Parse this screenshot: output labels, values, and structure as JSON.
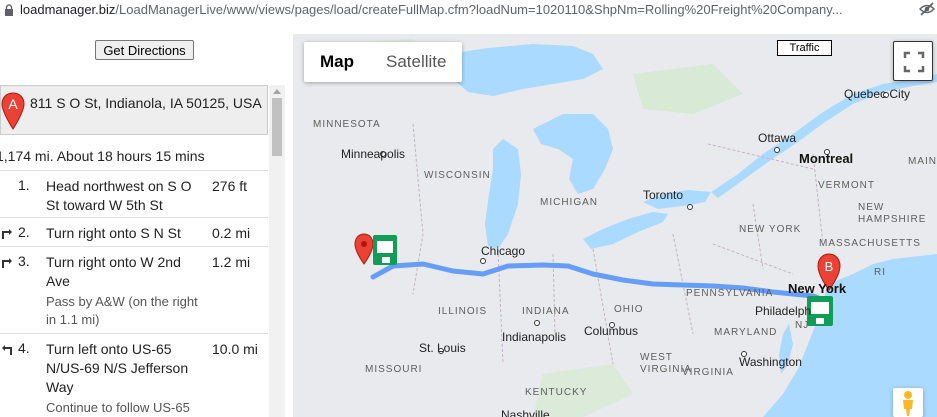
{
  "browser": {
    "url_host": "loadmanager.biz",
    "url_path": "/LoadManagerLive/www/views/pages/load/createFullMap.cfm?loadNum=1020110&ShpNm=Rolling%20Freight%20Company..."
  },
  "panel": {
    "get_directions_label": "Get Directions",
    "origin_marker": "A",
    "origin_address": "811 S O St, Indianola, IA 50125, USA",
    "summary": "1,174 mi. About 18 hours 15 mins",
    "steps": [
      {
        "num": "1.",
        "pre": "Head ",
        "b1": "northwest",
        "mid": " on ",
        "b2": "S O St",
        "mid2": " toward ",
        "b3": "W 5th St",
        "dist": "276 ft",
        "note": ""
      },
      {
        "num": "2.",
        "pre": "Turn ",
        "b1": "right",
        "mid": " onto ",
        "b2": "S N St",
        "mid2": "",
        "b3": "",
        "dist": "0.2 mi",
        "note": ""
      },
      {
        "num": "3.",
        "pre": "Turn ",
        "b1": "right",
        "mid": " onto ",
        "b2": "W 2nd Ave",
        "mid2": "",
        "b3": "",
        "dist": "1.2 mi",
        "note": "Pass by A&W (on the right in 1.1 mi)"
      },
      {
        "num": "4.",
        "pre": "Turn ",
        "b1": "left",
        "mid": " onto ",
        "b2": "US-65 N/US-69 N/S Jefferson Way",
        "mid2": "",
        "b3": "",
        "dist": "10.0 mi",
        "note": "Continue to follow US-65"
      }
    ]
  },
  "map": {
    "type_options": [
      "Map",
      "Satellite"
    ],
    "active_type": "Map",
    "traffic_label": "Traffic",
    "dest_marker": "B",
    "route_color": "#669df6",
    "water_color": "#aadaff",
    "land_color": "#e8eaed",
    "labels": {
      "quebec": "Quebec City",
      "minnesota": "MINNESOTA",
      "ottawa": "Ottawa",
      "minneapolis": "Minneapolis",
      "montreal": "Montreal",
      "wisconsin": "WISCONSIN",
      "michigan": "MICHIGAN",
      "toronto": "Toronto",
      "vermont": "VERMONT",
      "newhampshire": "NEW\nHAMPSHIRE",
      "newyork_state": "NEW YORK",
      "massachusetts": "MASSACHUSETTS",
      "chicago": "Chicago",
      "newyork": "New York",
      "pennsylvania": "PENNSYLVANIA",
      "philadelphia": "Philadelph",
      "nj": "NJ",
      "illinois": "ILLINOIS",
      "indiana": "INDIANA",
      "ohio": "OHIO",
      "indianapolis": "Indianapolis",
      "columbus": "Columbus",
      "maryland": "MARYLAND",
      "stlouis": "St. Louis",
      "westvirginia": "WEST\nVIRGINIA",
      "washington": "Washington",
      "missouri": "MISSOURI",
      "virginia": "VIRGINIA",
      "kentucky": "KENTUCKY",
      "ri": "RI",
      "main": "MAIN",
      "nashville": "Nashville"
    }
  }
}
